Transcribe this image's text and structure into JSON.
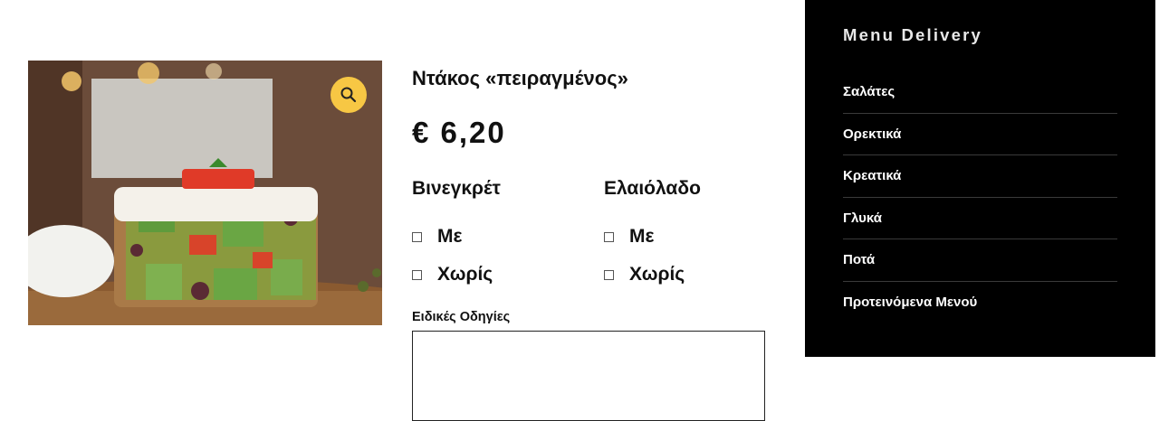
{
  "product": {
    "title": "Ντάκος «πειραγμένος»",
    "price": "€ 6,20",
    "zoom_icon": "search-icon"
  },
  "options": [
    {
      "title": "Βινεγκρέτ",
      "choices": [
        "Με",
        "Χωρίς"
      ]
    },
    {
      "title": "Ελαιόλαδο",
      "choices": [
        "Με",
        "Χωρίς"
      ]
    }
  ],
  "instructions": {
    "label": "Ειδικές Οδηγίες",
    "value": ""
  },
  "sidebar": {
    "title": "Menu Delivery",
    "items": [
      {
        "label": "Σαλάτες"
      },
      {
        "label": "Ορεκτικά"
      },
      {
        "label": "Κρεατικά"
      },
      {
        "label": "Γλυκά"
      },
      {
        "label": "Ποτά"
      },
      {
        "label": "Προτεινόμενα Μενού"
      }
    ]
  },
  "colors": {
    "accent_zoom": "#f7c744",
    "sidebar_bg": "#000000"
  }
}
